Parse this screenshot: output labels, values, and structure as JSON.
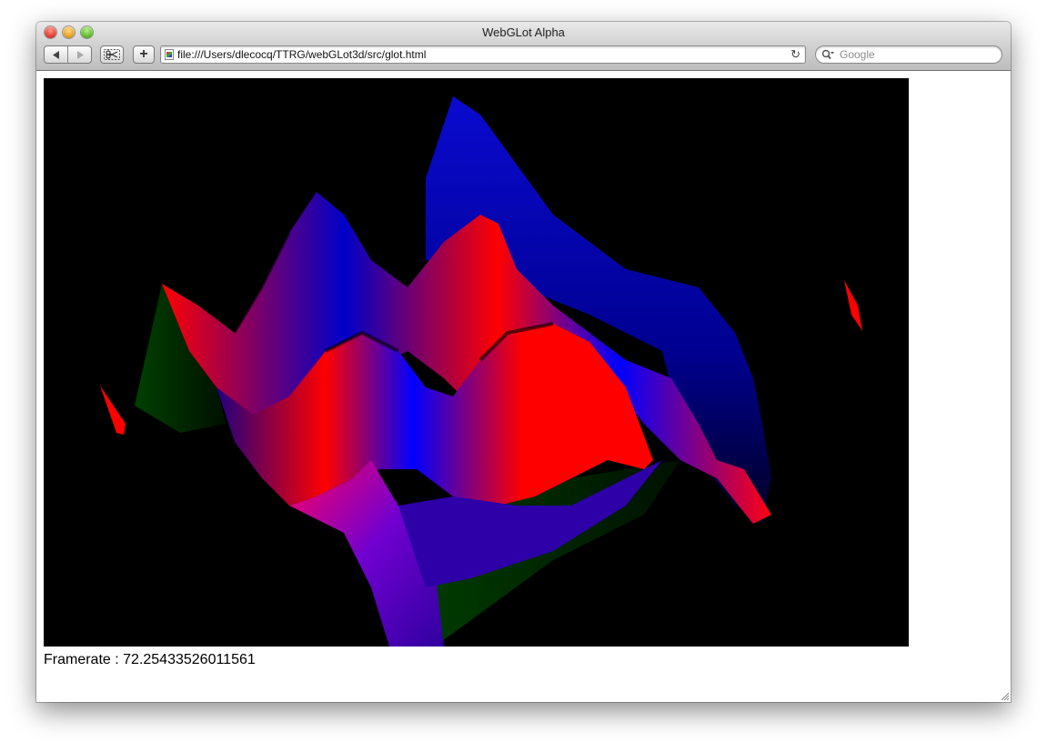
{
  "window": {
    "title": "WebGLot Alpha"
  },
  "toolbar": {
    "back_icon": "back-arrow-icon",
    "forward_icon": "forward-arrow-icon",
    "snip_icon": "scissors-icon",
    "add_label": "+",
    "address_url": "file:///Users/dlecocq/TTRG/webGLot3d/src/glot.html",
    "reload_icon": "reload-icon",
    "search_placeholder": "Google"
  },
  "page": {
    "framerate_label": "Framerate :",
    "framerate_value": "72.25433526011561"
  },
  "colors": {
    "canvas_bg": "#000000",
    "surface_red": "#ff0000",
    "surface_blue": "#0000ff",
    "surface_green": "#003a00"
  }
}
